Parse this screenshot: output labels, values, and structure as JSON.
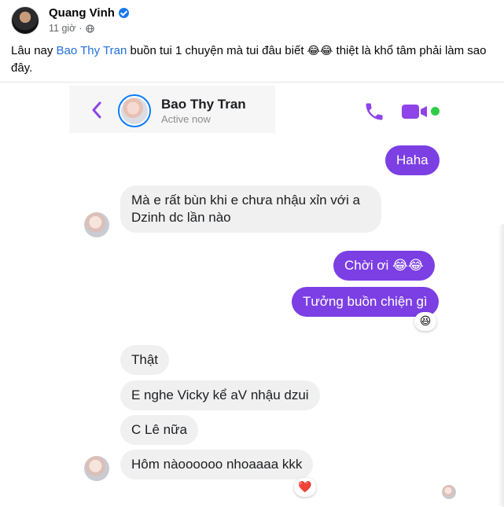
{
  "post": {
    "author": "Quang Vinh",
    "time": "11 giờ",
    "text_before": "Lâu nay ",
    "mention": "Bao Thy Tran",
    "text_after": " buồn tui 1 chuyện mà tui đâu biết ",
    "emojis": "😂😂",
    "text_end": " thiệt là khổ tâm phải làm sao đây."
  },
  "chat": {
    "contact_name": "Bao Thy Tran",
    "status": "Active now",
    "messages": [
      {
        "from": "me",
        "text": "Haha"
      },
      {
        "from": "them",
        "text": "Mà e rất bùn khi e chưa nhậu xỉn với a Dzinh dc lần nào"
      },
      {
        "from": "me",
        "text": "Chời ơi 😂😂"
      },
      {
        "from": "me",
        "text": "Tưởng buồn chiện gì"
      },
      {
        "from": "them",
        "text": "Thật"
      },
      {
        "from": "them",
        "text": "E nghe Vicky kể aV nhậu dzui"
      },
      {
        "from": "them",
        "text": "C Lê nữa"
      },
      {
        "from": "them",
        "text": "Hôm nàoooooo nhoaaaa kkk"
      }
    ],
    "reactions": {
      "laugh": "😆",
      "heart": "❤️"
    }
  },
  "colors": {
    "messenger_purple": "#7b3fe4",
    "incoming_bubble": "#f0f0f0",
    "mention_blue": "#216fdb",
    "online_green": "#31cc46"
  }
}
